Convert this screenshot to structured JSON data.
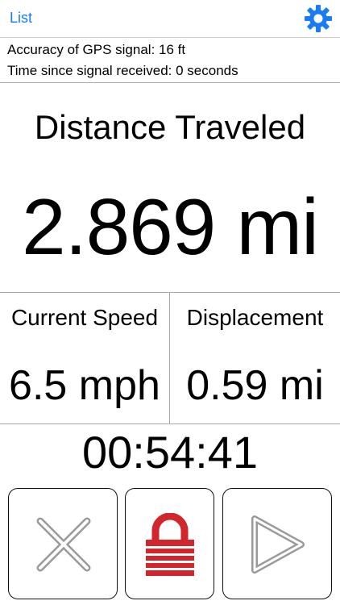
{
  "nav": {
    "list_label": "List",
    "settings_icon": "gear-icon",
    "accent_color": "#1a7cf5"
  },
  "gps": {
    "accuracy_text": "Accuracy of GPS signal: 16 ft",
    "time_since_text": "Time since signal received: 0 seconds"
  },
  "distance": {
    "label": "Distance Traveled",
    "value": "2.869 mi"
  },
  "speed": {
    "label": "Current Speed",
    "value": "6.5 mph"
  },
  "displacement": {
    "label": "Displacement",
    "value": "0.59 mi"
  },
  "timer": {
    "value": "00:54:41"
  },
  "controls": {
    "reset_icon": "x-icon",
    "lock_icon": "lock-icon",
    "lock_color": "#d0262c",
    "play_icon": "play-icon"
  }
}
